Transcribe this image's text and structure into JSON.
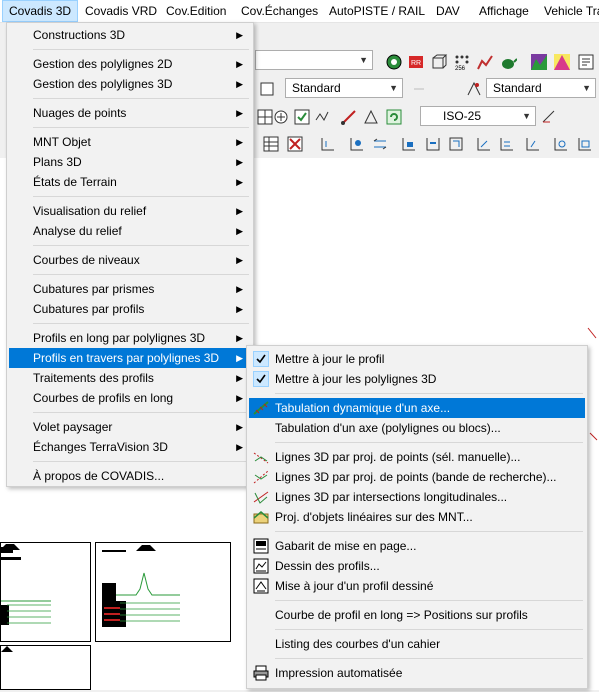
{
  "menubar": {
    "items": [
      "Covadis 3D",
      "Covadis VRD",
      "Cov.Edition",
      "Cov.Échanges",
      "AutoPISTE / RAIL",
      "DAV",
      "Affichage",
      "Vehicle Tra"
    ]
  },
  "toolbar": {
    "style_combo_1": "Standard",
    "style_combo_2": "Standard",
    "dimstyle_combo": "ISO-25"
  },
  "main_menu": {
    "groups": [
      [
        "Constructions 3D"
      ],
      [
        "Gestion des polylignes 2D",
        "Gestion des polylignes 3D"
      ],
      [
        "Nuages de points"
      ],
      [
        "MNT Objet",
        "Plans 3D",
        "États de Terrain"
      ],
      [
        "Visualisation du relief",
        "Analyse du relief"
      ],
      [
        "Courbes de niveaux"
      ],
      [
        "Cubatures par prismes",
        "Cubatures par profils"
      ],
      [
        "Profils en long par polylignes 3D",
        "Profils en travers par polylignes 3D",
        "Traitements des profils",
        "Courbes de profils en long"
      ],
      [
        "Volet paysager",
        "Échanges TerraVision 3D"
      ],
      [
        "À propos de COVADIS..."
      ]
    ],
    "highlighted": "Profils en travers par polylignes 3D"
  },
  "submenu": {
    "groups": [
      [
        {
          "label": "Mettre à jour le profil",
          "icon": "checkmark-icon"
        },
        {
          "label": "Mettre à jour les polylignes 3D",
          "icon": "checkmark-icon"
        }
      ],
      [
        {
          "label": "Tabulation dynamique d'un axe...",
          "icon": "axis-tabulation-icon"
        },
        {
          "label": "Tabulation d'un axe (polylignes ou blocs)...",
          "icon": ""
        }
      ],
      [
        {
          "label": "Lignes 3D par proj. de points (sél. manuelle)...",
          "icon": "projection-points-icon"
        },
        {
          "label": "Lignes 3D par proj. de points (bande de recherche)...",
          "icon": "projection-band-icon"
        },
        {
          "label": "Lignes 3D par intersections longitudinales...",
          "icon": "intersection-lines-icon"
        },
        {
          "label": "Proj. d'objets linéaires sur des MNT...",
          "icon": "mnt-projection-icon"
        }
      ],
      [
        {
          "label": "Gabarit de mise en page...",
          "icon": "layout-template-icon"
        },
        {
          "label": "Dessin des profils...",
          "icon": "profile-drawing-icon"
        },
        {
          "label": "Mise à jour d'un profil dessiné",
          "icon": "profile-update-icon"
        }
      ],
      [
        {
          "label": "Courbe de profil en long => Positions sur profils",
          "icon": ""
        }
      ],
      [
        {
          "label": "Listing des courbes d'un cahier",
          "icon": ""
        }
      ],
      [
        {
          "label": "Impression automatisée",
          "icon": "printer-icon"
        }
      ]
    ],
    "highlighted": "Tabulation dynamique d'un axe..."
  }
}
